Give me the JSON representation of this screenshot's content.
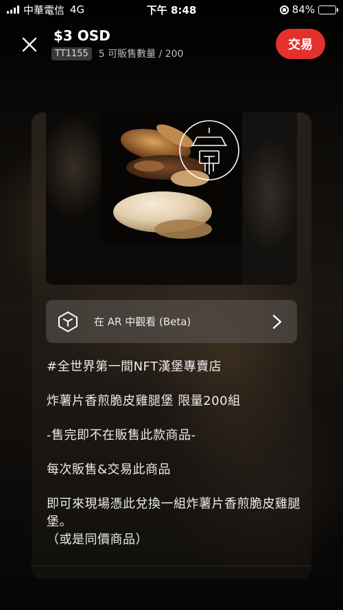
{
  "status_bar": {
    "carrier": "中華電信",
    "network": "4G",
    "time": "下午 8:48",
    "battery": "84%",
    "battery_level": 0.84
  },
  "header": {
    "title": "$3 OSD",
    "tag": "TT1155",
    "supply": "5 可販售數量 / 200",
    "trade_label": "交易"
  },
  "ar": {
    "label": "在 AR 中觀看 (Beta)"
  },
  "description": {
    "lines": [
      "#全世界第一間NFT漢堡專賣店",
      "炸薯片香煎脆皮雞腿堡 限量200組",
      "-售完即不在販售此款商品-",
      "每次販售&交易此商品",
      "即可來現場憑此兌換一組炸薯片香煎脆皮雞腿堡。\n（或是同價商品）"
    ]
  },
  "colors": {
    "accent": "#e4312b",
    "background": "#050505"
  },
  "icons": [
    "close-icon",
    "ar-cube-icon",
    "chevron-right-icon",
    "orientation-lock-icon",
    "battery-icon",
    "signal-icon"
  ]
}
